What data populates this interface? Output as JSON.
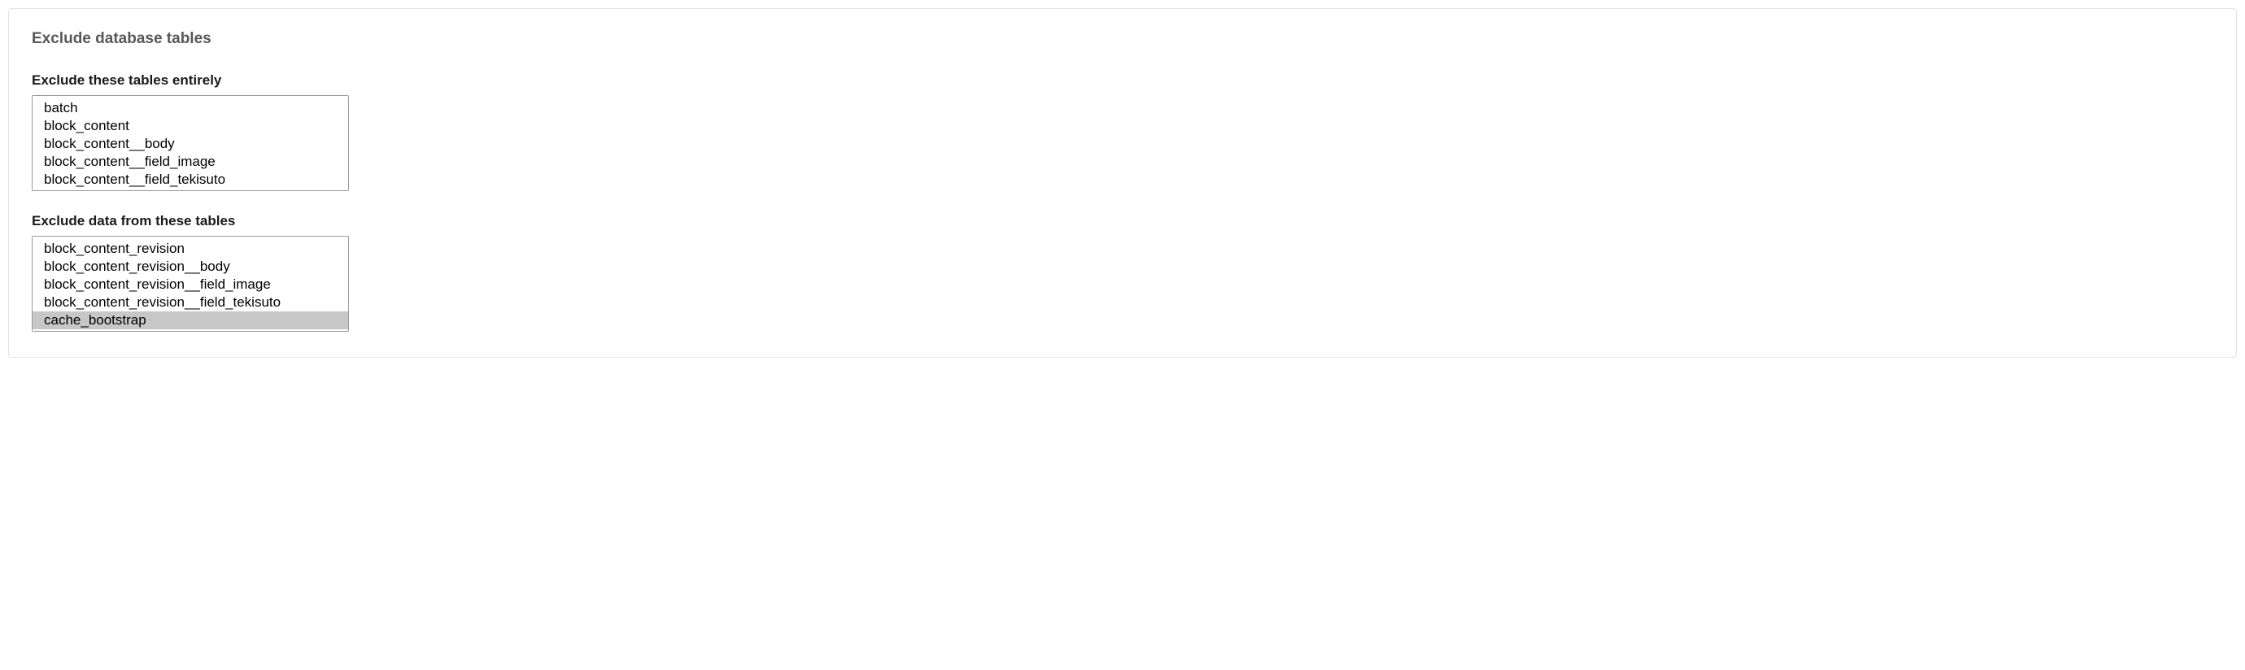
{
  "section": {
    "title": "Exclude database tables"
  },
  "exclude_entire": {
    "label": "Exclude these tables entirely",
    "options": [
      "batch",
      "block_content",
      "block_content__body",
      "block_content__field_image",
      "block_content__field_tekisuto"
    ],
    "selected": []
  },
  "exclude_data": {
    "label": "Exclude data from these tables",
    "options": [
      "block_content_revision",
      "block_content_revision__body",
      "block_content_revision__field_image",
      "block_content_revision__field_tekisuto",
      "cache_bootstrap"
    ],
    "selected": [
      "cache_bootstrap"
    ]
  }
}
